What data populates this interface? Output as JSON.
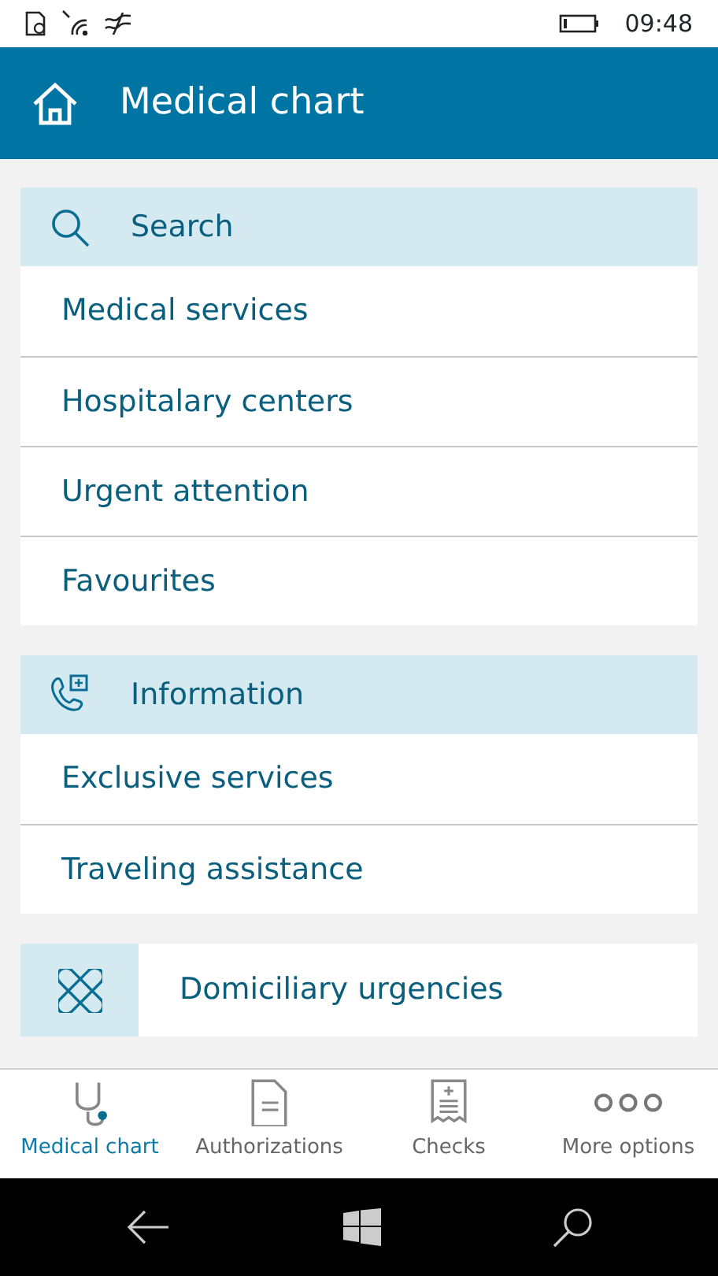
{
  "status_bar": {
    "time": "09:48"
  },
  "header": {
    "title": "Medical chart"
  },
  "sections": [
    {
      "kind": "group",
      "title": "Search",
      "items": [
        "Medical services",
        "Hospitalary centers",
        "Urgent attention",
        "Favourites"
      ]
    },
    {
      "kind": "group",
      "title": "Information",
      "items": [
        "Exclusive services",
        "Traveling assistance"
      ]
    },
    {
      "kind": "tile",
      "title": "Domiciliary urgencies"
    }
  ],
  "bottom_tabs": [
    {
      "label": "Medical chart",
      "selected": true
    },
    {
      "label": "Authorizations",
      "selected": false
    },
    {
      "label": "Checks",
      "selected": false
    },
    {
      "label": "More options",
      "selected": false
    }
  ]
}
